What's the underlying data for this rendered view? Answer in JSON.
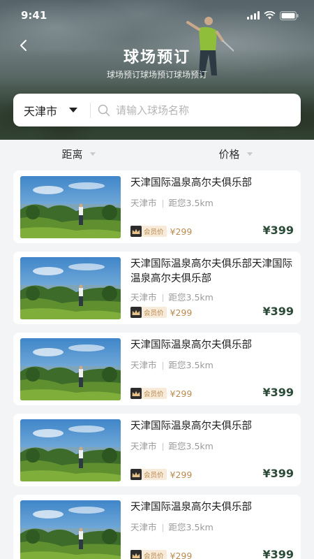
{
  "status": {
    "time": "9:41"
  },
  "header": {
    "title": "球场预订",
    "subtitle": "球场预订球场预订球场预订"
  },
  "search": {
    "city": "天津市",
    "placeholder": "请输入球场名称"
  },
  "sort": {
    "distance_label": "距离",
    "price_label": "价格"
  },
  "courses": [
    {
      "name": "天津国际温泉高尔夫俱乐部",
      "city": "天津市",
      "distance": "距您3.5km",
      "member_label": "会员价",
      "member_price": "¥299",
      "price": "¥399"
    },
    {
      "name": "天津国际温泉高尔夫俱乐部天津国际温泉高尔夫俱乐部",
      "city": "天津市",
      "distance": "距您3.5km",
      "member_label": "会员价",
      "member_price": "¥299",
      "price": "¥399"
    },
    {
      "name": "天津国际温泉高尔夫俱乐部",
      "city": "天津市",
      "distance": "距您3.5km",
      "member_label": "会员价",
      "member_price": "¥299",
      "price": "¥399"
    },
    {
      "name": "天津国际温泉高尔夫俱乐部",
      "city": "天津市",
      "distance": "距您3.5km",
      "member_label": "会员价",
      "member_price": "¥299",
      "price": "¥399"
    },
    {
      "name": "天津国际温泉高尔夫俱乐部",
      "city": "天津市",
      "distance": "距您3.5km",
      "member_label": "会员价",
      "member_price": "¥299",
      "price": "¥399"
    }
  ],
  "colors": {
    "price": "#2b4a37",
    "member_gold": "#b98a4e",
    "background": "#f3f4f6"
  }
}
